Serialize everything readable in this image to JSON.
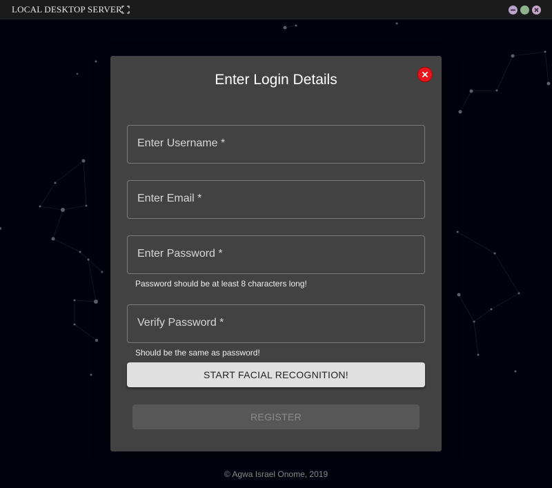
{
  "window": {
    "title": "LOCAL DESKTOP SERVER",
    "expand_icon": "expand-icon",
    "controls": [
      "minimize-icon",
      "maximize-icon",
      "close-icon"
    ]
  },
  "modal": {
    "title": "Enter Login Details",
    "close_icon": "close-icon",
    "fields": {
      "username": {
        "label": "Enter Username *",
        "value": ""
      },
      "email": {
        "label": "Enter Email *",
        "value": ""
      },
      "password": {
        "label": "Enter Password *",
        "value": "",
        "helper": "Password should be at least 8 characters long!"
      },
      "verify_password": {
        "label": "Verify Password *",
        "value": "",
        "helper": "Should be the same as password!"
      }
    },
    "face_button": "START FACIAL RECOGNITION!",
    "register_button": "REGISTER"
  },
  "footer": "© Agwa Israel Onome, 2019",
  "colors": {
    "background": "#02020f",
    "modal": "#424242",
    "close_red": "#e8141e",
    "face_button": "#e0e0e0",
    "register_button": "#575757"
  }
}
